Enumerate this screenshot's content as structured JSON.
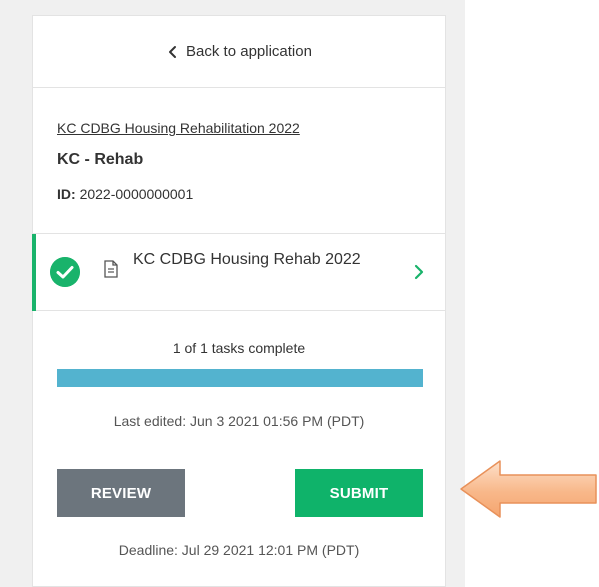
{
  "back_link": {
    "label": "Back to application",
    "icon": "chevron-left-icon"
  },
  "application": {
    "program_link": "KC CDBG Housing Rehabilitation 2022",
    "name": "KC - Rehab",
    "id_label": "ID:",
    "id_value": "2022-0000000001"
  },
  "task": {
    "title": "KC CDBG Housing Rehab 2022",
    "status_icon": "check-circle-icon",
    "type_icon": "document-icon",
    "nav_icon": "chevron-right-icon"
  },
  "progress": {
    "text": "1 of 1 tasks complete",
    "completed": 1,
    "total": 1
  },
  "last_edited": "Last edited: Jun 3 2021 01:56 PM (PDT)",
  "actions": {
    "review_label": "REVIEW",
    "submit_label": "SUBMIT"
  },
  "deadline": "Deadline: Jul 29 2021 12:01 PM (PDT)",
  "annotation": {
    "icon": "left-arrow-callout-icon"
  },
  "colors": {
    "accent_green": "#19b36b",
    "submit_green": "#0fb36a",
    "review_gray": "#6c757d",
    "progress_blue": "#53b3cf",
    "arrow_orange": "#f8b88a"
  }
}
